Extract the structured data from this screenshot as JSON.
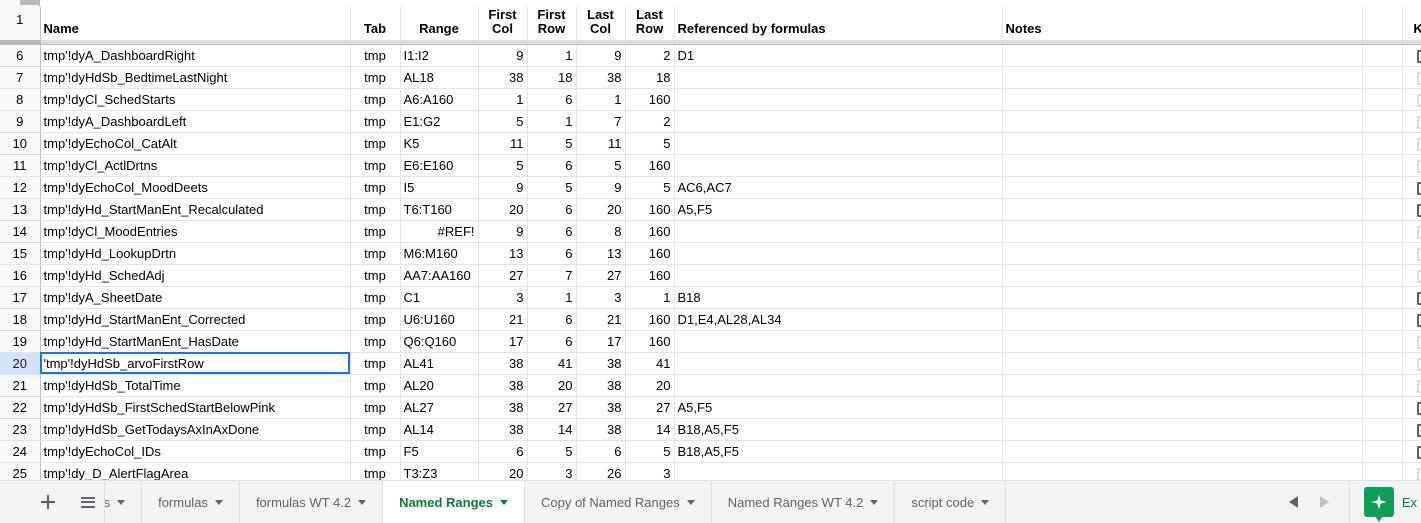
{
  "grid": {
    "frozen_row_label": "1",
    "columns": [
      {
        "key": "name",
        "header": "Name"
      },
      {
        "key": "tab",
        "header": "Tab"
      },
      {
        "key": "range",
        "header": "Range"
      },
      {
        "key": "first_col",
        "header": "First Col"
      },
      {
        "key": "first_row",
        "header": "First Row"
      },
      {
        "key": "last_col",
        "header": "Last Col"
      },
      {
        "key": "last_row",
        "header": "Last Row"
      },
      {
        "key": "refs",
        "header": "Referenced by formulas"
      },
      {
        "key": "notes",
        "header": "Notes"
      },
      {
        "key": "kill",
        "header": "Kill"
      }
    ],
    "headers": {
      "name": "Name",
      "tab": "Tab",
      "range": "Range",
      "first_col_l1": "First",
      "first_col_l2": "Col",
      "first_row_l1": "First",
      "first_row_l2": "Row",
      "last_col_l1": "Last",
      "last_col_l2": "Col",
      "last_row_l1": "Last",
      "last_row_l2": "Row",
      "refs": "Referenced by formulas",
      "notes": "Notes",
      "kill": "Kill"
    },
    "selected_row": 20,
    "rows": [
      {
        "n": "6",
        "name": "tmp'!dyA_DashboardRight",
        "tab": "tmp",
        "range": "I1:I2",
        "first_col": "9",
        "first_row": "1",
        "last_col": "9",
        "last_row": "2",
        "refs": "D1",
        "notes": "",
        "kill": true
      },
      {
        "n": "7",
        "name": "tmp'!dyHdSb_BedtimeLastNight",
        "tab": "tmp",
        "range": "AL18",
        "first_col": "38",
        "first_row": "18",
        "last_col": "38",
        "last_row": "18",
        "refs": "",
        "notes": "",
        "kill": false
      },
      {
        "n": "8",
        "name": "tmp'!dyCl_SchedStarts",
        "tab": "tmp",
        "range": "A6:A160",
        "first_col": "1",
        "first_row": "6",
        "last_col": "1",
        "last_row": "160",
        "refs": "",
        "notes": "",
        "kill": false
      },
      {
        "n": "9",
        "name": "tmp'!dyA_DashboardLeft",
        "tab": "tmp",
        "range": "E1:G2",
        "first_col": "5",
        "first_row": "1",
        "last_col": "7",
        "last_row": "2",
        "refs": "",
        "notes": "",
        "kill": false
      },
      {
        "n": "10",
        "name": "tmp'!dyEchoCol_CatAlt",
        "tab": "tmp",
        "range": "K5",
        "first_col": "11",
        "first_row": "5",
        "last_col": "11",
        "last_row": "5",
        "refs": "",
        "notes": "",
        "kill": false
      },
      {
        "n": "11",
        "name": "tmp'!dyCl_ActlDrtns",
        "tab": "tmp",
        "range": "E6:E160",
        "first_col": "5",
        "first_row": "6",
        "last_col": "5",
        "last_row": "160",
        "refs": "",
        "notes": "",
        "kill": false
      },
      {
        "n": "12",
        "name": "tmp'!dyEchoCol_MoodDeets",
        "tab": "tmp",
        "range": "I5",
        "first_col": "9",
        "first_row": "5",
        "last_col": "9",
        "last_row": "5",
        "refs": "AC6,AC7",
        "notes": "",
        "kill": true
      },
      {
        "n": "13",
        "name": "tmp'!dyHd_StartManEnt_Recalculated",
        "tab": "tmp",
        "range": "T6:T160",
        "first_col": "20",
        "first_row": "6",
        "last_col": "20",
        "last_row": "160",
        "refs": "A5,F5",
        "notes": "",
        "kill": true
      },
      {
        "n": "14",
        "name": "tmp'!dyCl_MoodEntries",
        "tab": "tmp",
        "range": "#REF!",
        "first_col": "9",
        "first_row": "6",
        "last_col": "8",
        "last_row": "160",
        "refs": "",
        "notes": "",
        "kill": false
      },
      {
        "n": "15",
        "name": "tmp'!dyHd_LookupDrtn",
        "tab": "tmp",
        "range": "M6:M160",
        "first_col": "13",
        "first_row": "6",
        "last_col": "13",
        "last_row": "160",
        "refs": "",
        "notes": "",
        "kill": false
      },
      {
        "n": "16",
        "name": "tmp'!dyHd_SchedAdj",
        "tab": "tmp",
        "range": "AA7:AA160",
        "first_col": "27",
        "first_row": "7",
        "last_col": "27",
        "last_row": "160",
        "refs": "",
        "notes": "",
        "kill": false
      },
      {
        "n": "17",
        "name": "tmp'!dyA_SheetDate",
        "tab": "tmp",
        "range": "C1",
        "first_col": "3",
        "first_row": "1",
        "last_col": "3",
        "last_row": "1",
        "refs": "B18",
        "notes": "",
        "kill": true
      },
      {
        "n": "18",
        "name": "tmp'!dyHd_StartManEnt_Corrected",
        "tab": "tmp",
        "range": "U6:U160",
        "first_col": "21",
        "first_row": "6",
        "last_col": "21",
        "last_row": "160",
        "refs": "D1,E4,AL28,AL34",
        "notes": "",
        "kill": true
      },
      {
        "n": "19",
        "name": "tmp'!dyHd_StartManEnt_HasDate",
        "tab": "tmp",
        "range": "Q6:Q160",
        "first_col": "17",
        "first_row": "6",
        "last_col": "17",
        "last_row": "160",
        "refs": "",
        "notes": "",
        "kill": false
      },
      {
        "n": "20",
        "name": "'tmp'!dyHdSb_arvoFirstRow",
        "tab": "tmp",
        "range": "AL41",
        "first_col": "38",
        "first_row": "41",
        "last_col": "38",
        "last_row": "41",
        "refs": "",
        "notes": "",
        "kill": false
      },
      {
        "n": "21",
        "name": "tmp'!dyHdSb_TotalTime",
        "tab": "tmp",
        "range": "AL20",
        "first_col": "38",
        "first_row": "20",
        "last_col": "38",
        "last_row": "20",
        "refs": "",
        "notes": "",
        "kill": false
      },
      {
        "n": "22",
        "name": "tmp'!dyHdSb_FirstSchedStartBelowPink",
        "tab": "tmp",
        "range": "AL27",
        "first_col": "38",
        "first_row": "27",
        "last_col": "38",
        "last_row": "27",
        "refs": "A5,F5",
        "notes": "",
        "kill": true
      },
      {
        "n": "23",
        "name": "tmp'!dyHdSb_GetTodaysAxInAxDone",
        "tab": "tmp",
        "range": "AL14",
        "first_col": "38",
        "first_row": "14",
        "last_col": "38",
        "last_row": "14",
        "refs": "B18,A5,F5",
        "notes": "",
        "kill": true
      },
      {
        "n": "24",
        "name": "tmp'!dyEchoCol_IDs",
        "tab": "tmp",
        "range": "F5",
        "first_col": "6",
        "first_row": "5",
        "last_col": "6",
        "last_row": "5",
        "refs": "B18,A5,F5",
        "notes": "",
        "kill": true
      },
      {
        "n": "25",
        "name": "tmp'!dy_D_AlertFlagArea",
        "tab": "tmp",
        "range": "T3:Z3",
        "first_col": "20",
        "first_row": "3",
        "last_col": "26",
        "last_row": "3",
        "refs": "",
        "notes": "",
        "kill": false
      }
    ]
  },
  "tabbar": {
    "add_label": "+",
    "all_sheets_label": "All sheets",
    "tabs": [
      {
        "label": "gions",
        "active": false,
        "clipped": true
      },
      {
        "label": "formulas",
        "active": false,
        "clipped": false
      },
      {
        "label": "formulas WT 4.2",
        "active": false,
        "clipped": false
      },
      {
        "label": "Named Ranges",
        "active": true,
        "clipped": false
      },
      {
        "label": "Copy of Named Ranges",
        "active": false,
        "clipped": false
      },
      {
        "label": "Named Ranges WT 4.2",
        "active": false,
        "clipped": false
      },
      {
        "label": "script code",
        "active": false,
        "clipped": false
      }
    ],
    "explore_label": "Ex"
  },
  "colors": {
    "selection_blue": "#1a73e8",
    "active_tab_green": "#0b7a3e",
    "explore_green": "#0f9d58",
    "grid_line": "#e2e3e3",
    "header_gutter": "#f8f9fa"
  }
}
